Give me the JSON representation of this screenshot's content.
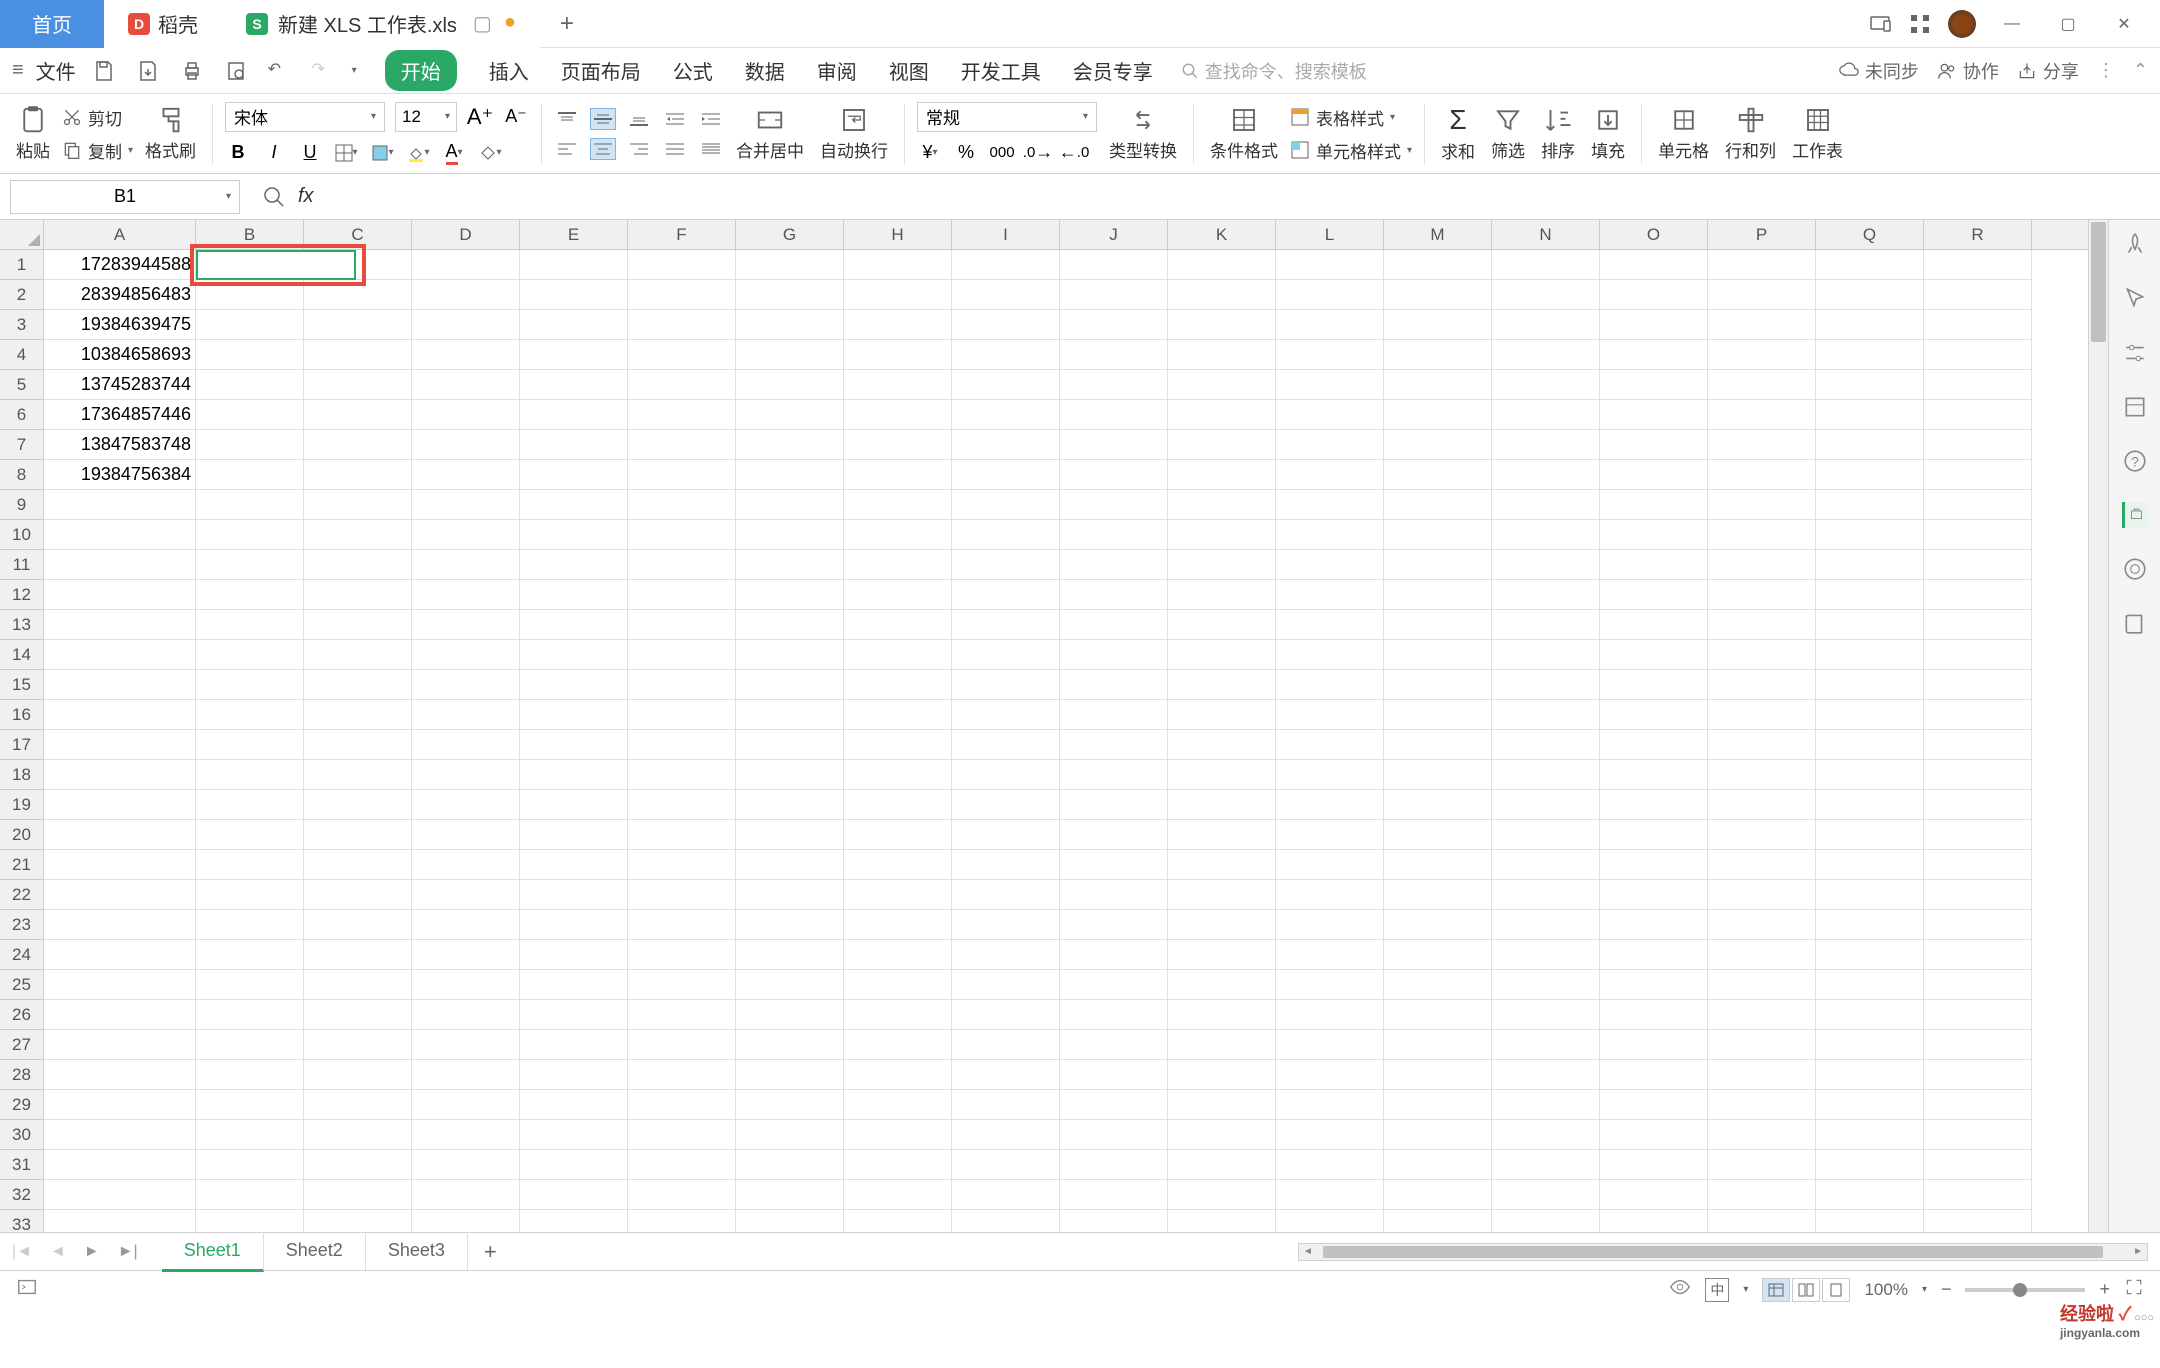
{
  "titlebar": {
    "home": "首页",
    "docTab1": "稻壳",
    "docTab2": "新建 XLS 工作表.xls",
    "unsaved_indicator": "●"
  },
  "menubar": {
    "file": "文件",
    "tabs": [
      "开始",
      "插入",
      "页面布局",
      "公式",
      "数据",
      "审阅",
      "视图",
      "开发工具",
      "会员专享"
    ],
    "activeTab": 0,
    "searchPlaceholder": "查找命令、搜索模板",
    "unsync": "未同步",
    "cooperate": "协作",
    "share": "分享"
  },
  "ribbon": {
    "paste": "粘贴",
    "cut": "剪切",
    "copy": "复制",
    "formatPainter": "格式刷",
    "font": "宋体",
    "fontSize": "12",
    "mergeCenter": "合并居中",
    "autoWrap": "自动换行",
    "numberFormat": "常规",
    "typeConvert": "类型转换",
    "condFormat": "条件格式",
    "tableStyle": "表格样式",
    "cellStyle": "单元格样式",
    "sum": "求和",
    "filter": "筛选",
    "sort": "排序",
    "fill": "填充",
    "cell": "单元格",
    "rowCol": "行和列",
    "worksheet": "工作表"
  },
  "formulaBar": {
    "nameBox": "B1",
    "formula": ""
  },
  "sheet": {
    "columns": [
      "A",
      "B",
      "C",
      "D",
      "E",
      "F",
      "G",
      "H",
      "I",
      "J",
      "K",
      "L",
      "M",
      "N",
      "O",
      "P",
      "Q",
      "R"
    ],
    "rowCount": 33,
    "data": {
      "A1": "17283944588",
      "A2": "28394856483",
      "A3": "19384639475",
      "A4": "10384658693",
      "A5": "13745283744",
      "A6": "17364857446",
      "A7": "13847583748",
      "A8": "19384756384"
    },
    "selected": "B1"
  },
  "sheetTabs": {
    "tabs": [
      "Sheet1",
      "Sheet2",
      "Sheet3"
    ],
    "active": 0
  },
  "statusBar": {
    "zoom": "100%"
  },
  "watermark": {
    "main": "经验啦",
    "sub": "jingyanla.com"
  }
}
